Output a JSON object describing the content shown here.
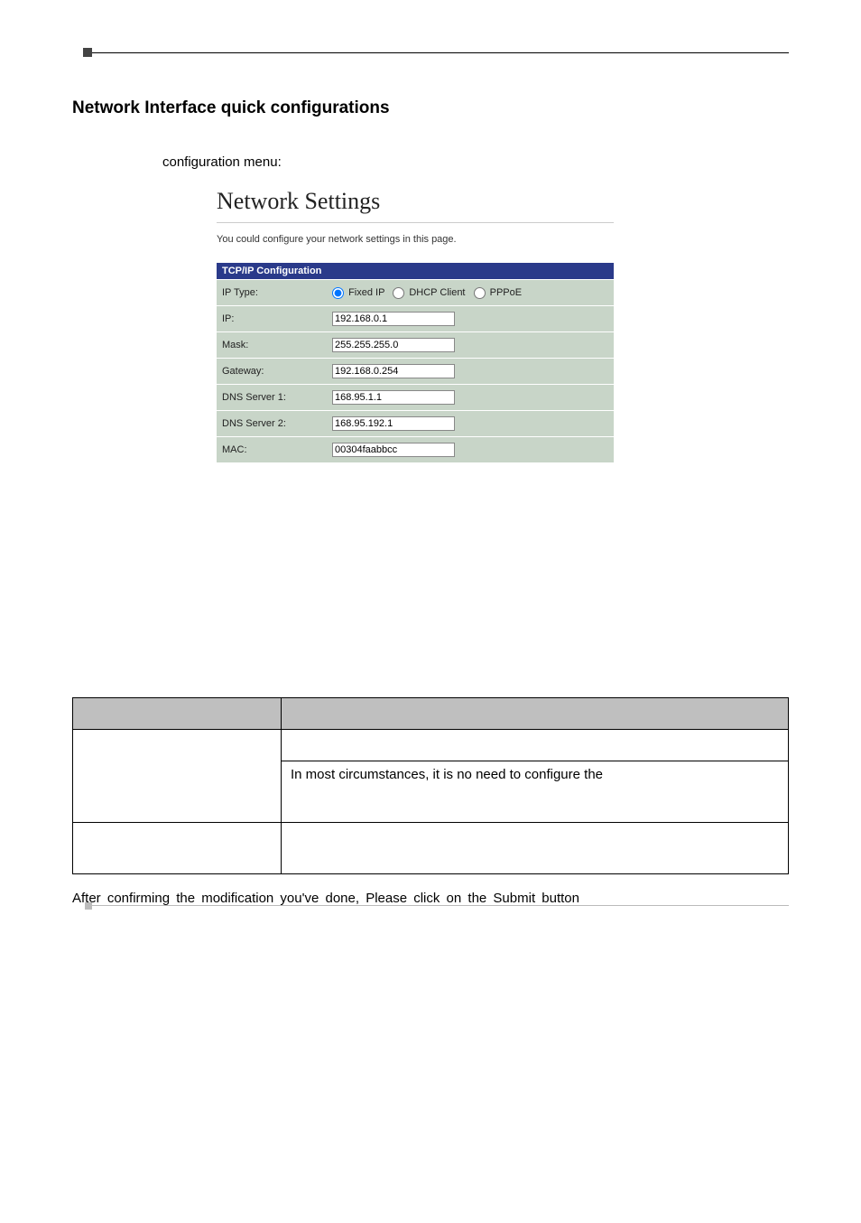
{
  "section_title": "Network Interface quick configurations",
  "intro_text": "configuration menu:",
  "settings": {
    "heading": "Network Settings",
    "description": "You could configure your network settings in this page.",
    "table_header": "TCP/IP Configuration",
    "rows": {
      "ip_type_label": "IP Type:",
      "ip_type_options": {
        "fixed": "Fixed IP",
        "dhcp": "DHCP Client",
        "pppoe": "PPPoE"
      },
      "ip_label": "IP:",
      "ip_value": "192.168.0.1",
      "mask_label": "Mask:",
      "mask_value": "255.255.255.0",
      "gateway_label": "Gateway:",
      "gateway_value": "192.168.0.254",
      "dns1_label": "DNS Server 1:",
      "dns1_value": "168.95.1.1",
      "dns2_label": "DNS Server 2:",
      "dns2_value": "168.95.192.1",
      "mac_label": "MAC:",
      "mac_value": "00304faabbcc"
    }
  },
  "desc_table": {
    "row2_right": "In most circumstances, it is no need to configure the"
  },
  "after_text": "After confirming the modification you've done, Please click on the Submit button"
}
